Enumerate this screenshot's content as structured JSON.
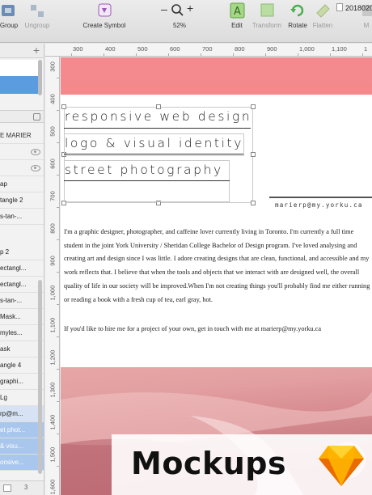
{
  "window": {
    "title": "2018020"
  },
  "toolbar": {
    "items": [
      {
        "id": "group",
        "label": "Group",
        "enabled": true
      },
      {
        "id": "ungroup",
        "label": "Ungroup",
        "enabled": false
      },
      {
        "id": "create-symbol",
        "label": "Create Symbol",
        "enabled": true
      },
      {
        "id": "zoom",
        "label": "52%",
        "minus": "–",
        "plus": "+"
      },
      {
        "id": "edit",
        "label": "Edit",
        "enabled": true
      },
      {
        "id": "transform",
        "label": "Transform",
        "enabled": false
      },
      {
        "id": "rotate",
        "label": "Rotate",
        "enabled": true
      },
      {
        "id": "flatten",
        "label": "Flatten",
        "enabled": false
      },
      {
        "id": "mask",
        "label": "M",
        "enabled": false
      }
    ]
  },
  "sidebar": {
    "add": "+",
    "page_group": "E MARIER",
    "layers_top": [
      "ap",
      "tangle 2",
      "s-tan-..."
    ],
    "layers": [
      "p 2",
      "ectangl...",
      "ectangl...",
      "s-tan-...",
      "Mask...",
      "myles...",
      "ask",
      "angle 4",
      "graphi...",
      "Lg",
      "rp@m...",
      "et phot...",
      "& visu...",
      "onsive..."
    ],
    "footer": "3"
  },
  "rulers": {
    "top": [
      "300",
      "400",
      "500",
      "600",
      "700",
      "800",
      "900",
      "1,000",
      "1,100",
      "1"
    ],
    "left": [
      "300",
      "400",
      "500",
      "600",
      "700",
      "800",
      "900",
      "1,000",
      "1,100",
      "1,200",
      "1,300",
      "1,400",
      "1,500",
      "1,600"
    ]
  },
  "artboard": {
    "nav": [
      "responsive web design",
      "logo & visual identity",
      "street photography"
    ],
    "email": "marierp@my.yorku.ca",
    "bio": "I'm a graphic designer, photographer, and caffeine lover currently living in Toronto. I'm currently a full time student in the joint York University / Sheridan College Bachelor of Design program. I've loved analysing and creating art and design since I was little. I adore creating designs that are clean, functional, and accessible and my work reflects that. I believe that when the tools and objects that we interact with are designed well, the overall quality of life in our society will be improved.When I'm not creating things you'll probably find me either running or reading a book with a fresh cup of tea, earl gray, hot.",
    "contact": "If you'd like to hire me for a project of your own, get in touch with me at marierp@my.yorku.ca",
    "banner_color": "#f48a8e"
  },
  "badge": {
    "text": "Mockups",
    "logo": "sketch-diamond-icon"
  }
}
